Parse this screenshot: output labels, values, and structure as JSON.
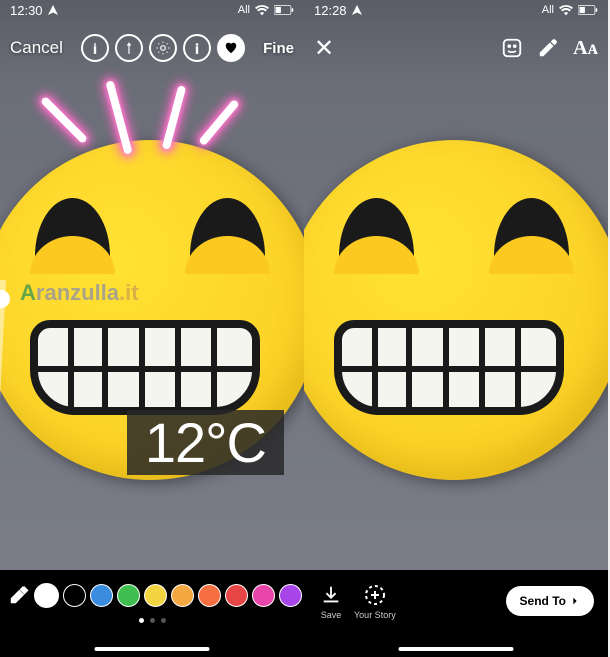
{
  "left": {
    "status": {
      "time": "12:30",
      "carrier": "All"
    },
    "toolbar": {
      "cancel": "Cancel",
      "done": "Fine"
    },
    "watermark": {
      "first": "A",
      "middle": "ranzulla",
      "last": ".it"
    },
    "temperature": "12°C",
    "colors": [
      "#ffffff",
      "#000000",
      "#3a8dde",
      "#3fbf4f",
      "#f5d442",
      "#f5a742",
      "#f56f42",
      "#e84545",
      "#e845a8",
      "#a845e8"
    ]
  },
  "right": {
    "status": {
      "time": "12:28",
      "carrier": "All"
    },
    "text_tool": "Aᴀ",
    "actions": {
      "save_label": "Save",
      "story_label": "Your Story",
      "send_to": "Send To"
    }
  }
}
